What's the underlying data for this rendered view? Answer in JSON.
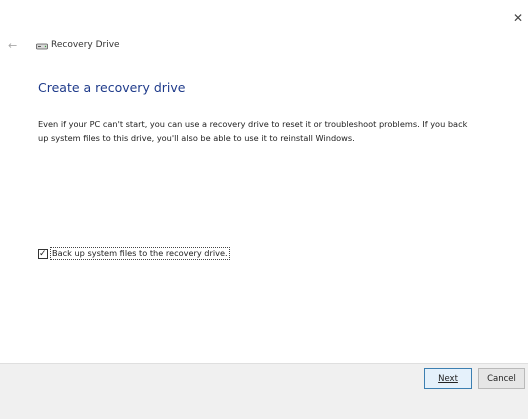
{
  "window": {
    "title": "Recovery Drive",
    "close_glyph": "✕",
    "back_glyph": "←"
  },
  "main": {
    "heading": "Create a recovery drive",
    "description": "Even if your PC can't start, you can use a recovery drive to reset it or troubleshoot problems. If you back up system files to this drive, you'll also be able to use it to reinstall Windows.",
    "checkbox": {
      "label": "Back up system files to the recovery drive.",
      "checked": true
    }
  },
  "footer": {
    "next_label": "Next",
    "cancel_label": "Cancel"
  },
  "colors": {
    "heading": "#1e3a8a",
    "footer_bg": "#f0f0f0",
    "next_border": "#3c7fb1"
  },
  "icons": {
    "drive": "drive-icon",
    "back": "back-arrow-icon",
    "close": "close-icon",
    "check": "checkmark-icon"
  }
}
